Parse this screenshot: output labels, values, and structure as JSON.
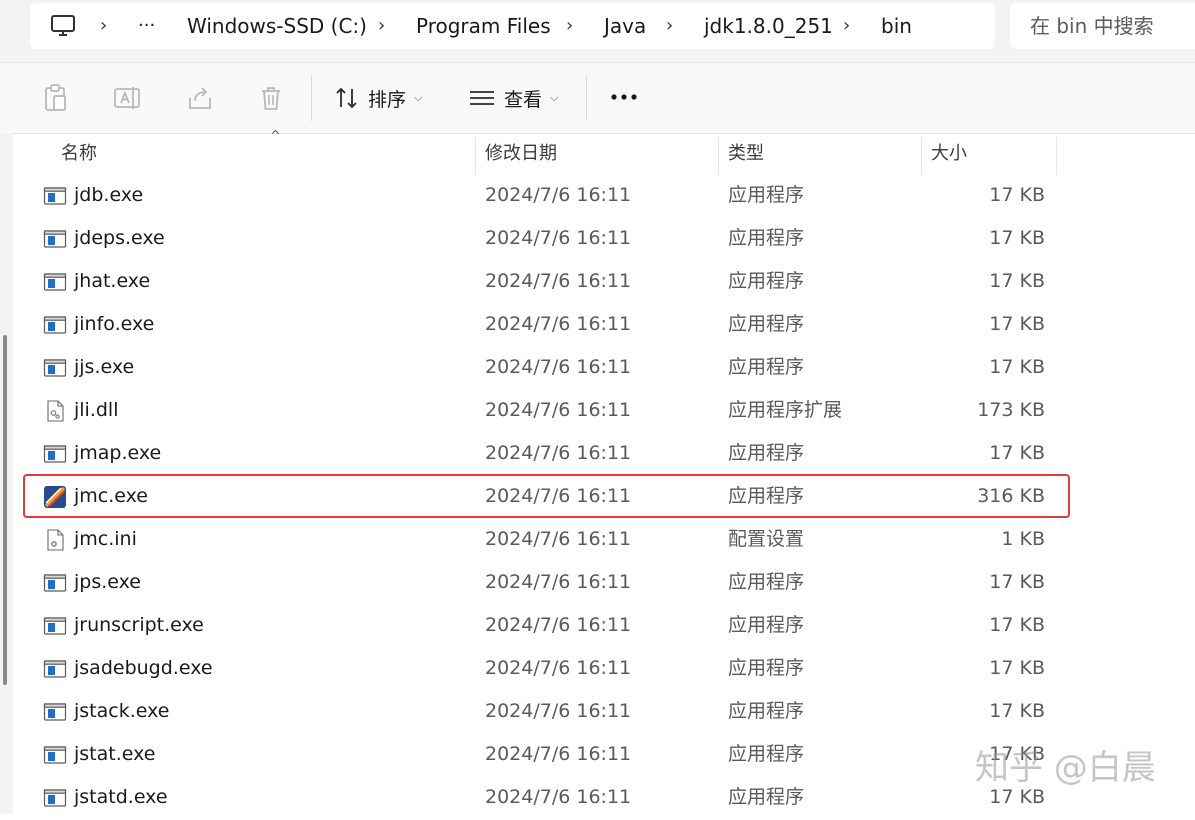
{
  "breadcrumb": {
    "items": [
      "Windows-SSD (C:)",
      "Program Files",
      "Java",
      "jdk1.8.0_251",
      "bin"
    ],
    "overflow_label": "···"
  },
  "search": {
    "placeholder": "在 bin 中搜索"
  },
  "toolbar": {
    "sort_label": "排序",
    "view_label": "查看",
    "more_label": "···"
  },
  "columns": {
    "name": "名称",
    "modified": "修改日期",
    "type": "类型",
    "size": "大小"
  },
  "files": [
    {
      "name": "jdb.exe",
      "modified": "2024/7/6 16:11",
      "type": "应用程序",
      "size": "17 KB",
      "icon": "exe-icon"
    },
    {
      "name": "jdeps.exe",
      "modified": "2024/7/6 16:11",
      "type": "应用程序",
      "size": "17 KB",
      "icon": "exe-icon"
    },
    {
      "name": "jhat.exe",
      "modified": "2024/7/6 16:11",
      "type": "应用程序",
      "size": "17 KB",
      "icon": "exe-icon"
    },
    {
      "name": "jinfo.exe",
      "modified": "2024/7/6 16:11",
      "type": "应用程序",
      "size": "17 KB",
      "icon": "exe-icon"
    },
    {
      "name": "jjs.exe",
      "modified": "2024/7/6 16:11",
      "type": "应用程序",
      "size": "17 KB",
      "icon": "exe-icon"
    },
    {
      "name": "jli.dll",
      "modified": "2024/7/6 16:11",
      "type": "应用程序扩展",
      "size": "173 KB",
      "icon": "dll-icon"
    },
    {
      "name": "jmap.exe",
      "modified": "2024/7/6 16:11",
      "type": "应用程序",
      "size": "17 KB",
      "icon": "exe-icon"
    },
    {
      "name": "jmc.exe",
      "modified": "2024/7/6 16:11",
      "type": "应用程序",
      "size": "316 KB",
      "icon": "jmc-app-icon"
    },
    {
      "name": "jmc.ini",
      "modified": "2024/7/6 16:11",
      "type": "配置设置",
      "size": "1 KB",
      "icon": "ini-icon"
    },
    {
      "name": "jps.exe",
      "modified": "2024/7/6 16:11",
      "type": "应用程序",
      "size": "17 KB",
      "icon": "exe-icon"
    },
    {
      "name": "jrunscript.exe",
      "modified": "2024/7/6 16:11",
      "type": "应用程序",
      "size": "17 KB",
      "icon": "exe-icon"
    },
    {
      "name": "jsadebugd.exe",
      "modified": "2024/7/6 16:11",
      "type": "应用程序",
      "size": "17 KB",
      "icon": "exe-icon"
    },
    {
      "name": "jstack.exe",
      "modified": "2024/7/6 16:11",
      "type": "应用程序",
      "size": "17 KB",
      "icon": "exe-icon"
    },
    {
      "name": "jstat.exe",
      "modified": "2024/7/6 16:11",
      "type": "应用程序",
      "size": "17 KB",
      "icon": "exe-icon"
    },
    {
      "name": "jstatd.exe",
      "modified": "2024/7/6 16:11",
      "type": "应用程序",
      "size": "17 KB",
      "icon": "exe-icon"
    }
  ],
  "highlight_color": "#e0393e",
  "watermark": "知乎 @白晨"
}
